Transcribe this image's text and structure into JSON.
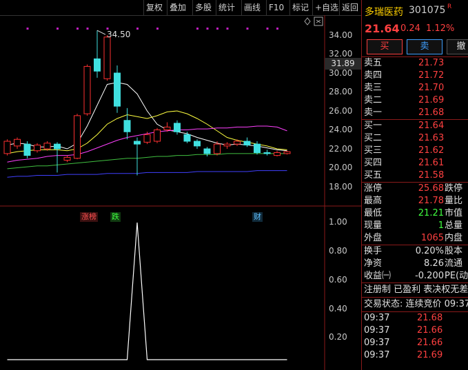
{
  "toolbar": {
    "buttons": [
      "复权",
      "叠加",
      "多股",
      "统计",
      "画线",
      "F10",
      "标记",
      "+自选",
      "返回"
    ]
  },
  "chart": {
    "high_label": "34.50",
    "current_price_tag": "31.89",
    "y_ticks_main": [
      "34.00",
      "32.00",
      "30.00",
      "28.00",
      "26.00",
      "24.00",
      "22.00",
      "20.00",
      "18.00"
    ],
    "y_ticks_sub": [
      "1.00",
      "0.80",
      "0.60",
      "0.40",
      "0.20"
    ],
    "events": [
      {
        "label": "涨榜",
        "color": "#ff5050"
      },
      {
        "label": "跌",
        "color": "#40ff40"
      },
      {
        "label": "财",
        "color": "#60c0ff"
      }
    ]
  },
  "chart_data": {
    "type": "candlestick",
    "ylim": [
      17.5,
      35.5
    ],
    "candles": [
      {
        "o": 21.5,
        "c": 22.8,
        "h": 23.0,
        "l": 21.3
      },
      {
        "o": 22.3,
        "c": 23.0,
        "h": 23.2,
        "l": 22.0
      },
      {
        "o": 22.5,
        "c": 21.3,
        "h": 22.8,
        "l": 21.0
      },
      {
        "o": 21.8,
        "c": 22.4,
        "h": 22.6,
        "l": 21.6
      },
      {
        "o": 22.0,
        "c": 22.6,
        "h": 22.8,
        "l": 21.8
      },
      {
        "o": 22.5,
        "c": 22.0,
        "h": 22.7,
        "l": 19.5
      },
      {
        "o": 20.8,
        "c": 21.1,
        "h": 21.3,
        "l": 20.6
      },
      {
        "o": 21.0,
        "c": 25.5,
        "h": 25.7,
        "l": 20.9
      },
      {
        "o": 25.7,
        "c": 30.7,
        "h": 30.9,
        "l": 25.5
      },
      {
        "o": 31.5,
        "c": 30.2,
        "h": 34.5,
        "l": 29.5
      },
      {
        "o": 29.4,
        "c": 33.8,
        "h": 34.0,
        "l": 29.2
      },
      {
        "o": 30.0,
        "c": 26.5,
        "h": 30.8,
        "l": 25.8
      },
      {
        "o": 25.0,
        "c": 23.8,
        "h": 26.3,
        "l": 23.0
      },
      {
        "o": 22.8,
        "c": 22.5,
        "h": 23.2,
        "l": 19.2
      },
      {
        "o": 22.7,
        "c": 23.5,
        "h": 23.8,
        "l": 22.5
      },
      {
        "o": 22.8,
        "c": 24.0,
        "h": 24.2,
        "l": 22.6
      },
      {
        "o": 24.0,
        "c": 24.3,
        "h": 24.8,
        "l": 23.8
      },
      {
        "o": 24.7,
        "c": 23.8,
        "h": 25.0,
        "l": 23.5
      },
      {
        "o": 23.5,
        "c": 22.8,
        "h": 23.8,
        "l": 22.6
      },
      {
        "o": 22.8,
        "c": 22.3,
        "h": 23.0,
        "l": 22.0
      },
      {
        "o": 22.0,
        "c": 21.5,
        "h": 22.2,
        "l": 21.2
      },
      {
        "o": 21.5,
        "c": 22.5,
        "h": 22.8,
        "l": 21.3
      },
      {
        "o": 22.3,
        "c": 22.5,
        "h": 22.7,
        "l": 22.0
      },
      {
        "o": 22.5,
        "c": 22.8,
        "h": 23.0,
        "l": 22.3
      },
      {
        "o": 22.8,
        "c": 22.4,
        "h": 23.2,
        "l": 22.2
      },
      {
        "o": 22.5,
        "c": 21.6,
        "h": 22.8,
        "l": 21.4
      },
      {
        "o": 21.6,
        "c": 21.5,
        "h": 21.9,
        "l": 21.3
      },
      {
        "o": 21.3,
        "c": 21.6,
        "h": 21.8,
        "l": 21.2
      },
      {
        "o": 21.5,
        "c": 21.7,
        "h": 21.8,
        "l": 21.4
      }
    ],
    "ma_lines": [
      {
        "color": "#ffffff",
        "values": [
          22.4,
          22.6,
          22.5,
          22.2,
          22.2,
          22.3,
          22.0,
          22.6,
          24.4,
          26.6,
          28.8,
          29.0,
          28.8,
          27.8,
          26.0,
          24.6,
          24.0,
          23.8,
          23.6,
          23.2,
          22.9,
          22.6,
          22.4,
          22.5,
          22.4,
          22.3,
          22.1,
          21.9,
          21.8
        ]
      },
      {
        "color": "#ffff40",
        "values": [
          21.5,
          21.7,
          21.8,
          21.9,
          21.9,
          21.9,
          21.8,
          22.0,
          22.6,
          23.5,
          24.6,
          25.2,
          25.6,
          25.4,
          25.2,
          25.5,
          25.9,
          26.0,
          25.7,
          25.2,
          24.6,
          23.9,
          23.2,
          22.9,
          22.7,
          22.5,
          22.3,
          22.0,
          21.9
        ]
      },
      {
        "color": "#ff40ff",
        "values": [
          20.6,
          20.8,
          20.9,
          21.0,
          21.2,
          21.3,
          21.3,
          21.4,
          21.7,
          22.1,
          22.5,
          22.9,
          23.2,
          23.4,
          23.6,
          23.8,
          23.9,
          24.0,
          24.0,
          24.1,
          24.1,
          24.2,
          24.2,
          24.3,
          24.3,
          24.4,
          24.4,
          24.3,
          23.9
        ]
      },
      {
        "color": "#40c040",
        "values": [
          19.9,
          20.0,
          20.1,
          20.2,
          20.2,
          20.3,
          20.4,
          20.5,
          20.6,
          20.7,
          20.8,
          20.9,
          21.0,
          21.0,
          21.1,
          21.2,
          21.2,
          21.3,
          21.3,
          21.4,
          21.4,
          21.4,
          21.5,
          21.5,
          21.5,
          21.5,
          21.5,
          21.5,
          21.5
        ]
      },
      {
        "color": "#4040ff",
        "values": [
          19.0,
          19.1,
          19.1,
          19.2,
          19.2,
          19.2,
          19.3,
          19.3,
          19.3,
          19.3,
          19.4,
          19.4,
          19.4,
          19.4,
          19.5,
          19.5,
          19.5,
          19.5,
          19.5,
          19.6,
          19.6,
          19.6,
          19.6,
          19.6,
          19.6,
          19.7,
          19.7,
          19.7,
          19.7
        ]
      }
    ],
    "indicator": {
      "ylim": [
        0,
        1.0
      ],
      "values": [
        0,
        0,
        0,
        0,
        0,
        0,
        0,
        0,
        0,
        0,
        0,
        0,
        0,
        1.0,
        0,
        0,
        0,
        0,
        0,
        0,
        0,
        0,
        0,
        0,
        0,
        0,
        0,
        0,
        0
      ]
    }
  },
  "quote": {
    "name": "多瑞医药",
    "code": "301075",
    "flag": "R",
    "price": "21.64",
    "change": "0.24",
    "change_pct": "1.12%",
    "buy_label": "买",
    "sell_label": "卖",
    "cancel_label": "撤",
    "asks": [
      {
        "label": "卖五",
        "price": "21.73"
      },
      {
        "label": "卖四",
        "price": "21.72"
      },
      {
        "label": "卖三",
        "price": "21.70"
      },
      {
        "label": "卖二",
        "price": "21.69"
      },
      {
        "label": "卖一",
        "price": "21.68"
      }
    ],
    "bids": [
      {
        "label": "买一",
        "price": "21.64"
      },
      {
        "label": "买二",
        "price": "21.63"
      },
      {
        "label": "买三",
        "price": "21.62"
      },
      {
        "label": "买四",
        "price": "21.61"
      },
      {
        "label": "买五",
        "price": "21.58"
      }
    ],
    "stats": [
      {
        "label": "涨停",
        "value": "25.68",
        "color": "#ff4040",
        "right": "跌停"
      },
      {
        "label": "最高",
        "value": "21.78",
        "color": "#ff4040",
        "right": "量比"
      },
      {
        "label": "最低",
        "value": "21.21",
        "color": "#40ff40",
        "right": "市值"
      },
      {
        "label": "现量",
        "value": "1",
        "color": "#40ff40",
        "right": "总量"
      },
      {
        "label": "外盘",
        "value": "1065",
        "color": "#ff4040",
        "right": "内盘"
      }
    ],
    "stats2": [
      {
        "label": "换手",
        "value": "0.20%",
        "right": "股本"
      },
      {
        "label": "净资",
        "value": "8.26",
        "right": "流通"
      },
      {
        "label": "收益㈠",
        "value": "-0.200",
        "right": "PE(动"
      }
    ],
    "info_line1": "注册制 已盈利 表决权无差",
    "info_line2": "交易状态: 连续竞价 09:37",
    "ticks": [
      {
        "time": "09:37",
        "price": "21.68"
      },
      {
        "time": "09:37",
        "price": "21.66"
      },
      {
        "time": "09:37",
        "price": "21.66"
      },
      {
        "time": "09:37",
        "price": "21.69"
      }
    ]
  }
}
